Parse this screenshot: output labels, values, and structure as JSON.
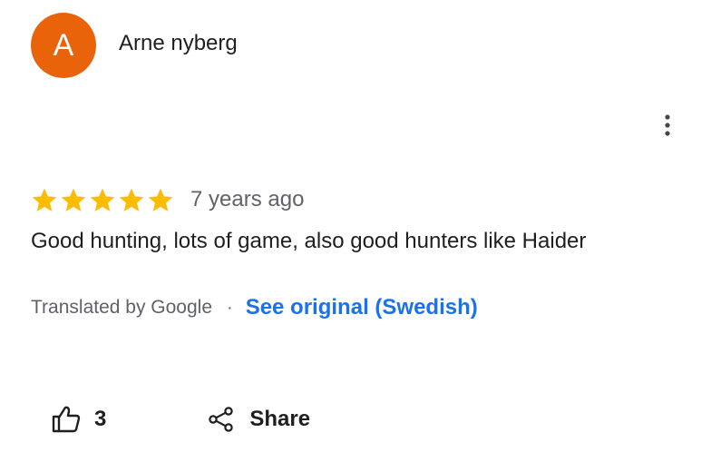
{
  "review": {
    "author": {
      "avatar_letter": "A",
      "avatar_color": "#e8630a",
      "name": "Arne nyberg"
    },
    "rating": 5,
    "rating_max": 5,
    "star_color": "#fbbc04",
    "time_ago": "7 years ago",
    "text": "Good hunting, lots of game, also good hunters like Haider",
    "translation": {
      "translated_by": "Translated by Google",
      "separator": "·",
      "see_original": "See original (Swedish)",
      "link_color": "#1a73e8"
    },
    "actions": {
      "like_icon": "thumbs-up-icon",
      "like_count": "3",
      "share_icon": "share-icon",
      "share_label": "Share",
      "more_icon": "more-vert-icon"
    }
  }
}
